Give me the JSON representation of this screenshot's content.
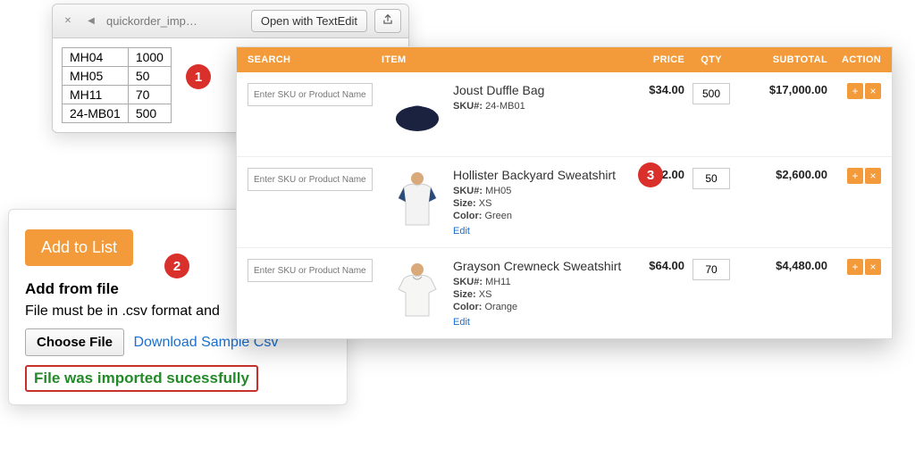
{
  "callouts": {
    "one": "1",
    "two": "2",
    "three": "3"
  },
  "csv": {
    "filename": "quickorder_imp…",
    "open_with_label": "Open with TextEdit",
    "rows": [
      {
        "sku": "MH04",
        "qty": "1000"
      },
      {
        "sku": "MH05",
        "qty": "50"
      },
      {
        "sku": "MH11",
        "qty": "70"
      },
      {
        "sku": "24-MB01",
        "qty": "500"
      }
    ]
  },
  "addfile": {
    "add_to_list_label": "Add to List",
    "heading": "Add from file",
    "note": "File must be in .csv format and",
    "choose_label": "Choose File",
    "download_label": "Download Sample Csv",
    "success_msg": "File was imported sucessfully"
  },
  "grid": {
    "headers": {
      "search": "SEARCH",
      "item": "ITEM",
      "price": "PRICE",
      "qty": "QTY",
      "subtotal": "SUBTOTAL",
      "action": "ACTION"
    },
    "sku_placeholder": "Enter SKU or Product Name",
    "sku_prefix": "SKU#:",
    "size_label": "Size:",
    "color_label": "Color:",
    "edit_label": "Edit",
    "rows": [
      {
        "name": "Joust Duffle Bag",
        "sku": "24-MB01",
        "price": "$34.00",
        "qty": "500",
        "subtotal": "$17,000.00",
        "has_options": false,
        "thumb_kind": "bag"
      },
      {
        "name": "Hollister Backyard Sweatshirt",
        "sku": "MH05",
        "size": "XS",
        "color": "Green",
        "price": "$52.00",
        "qty": "50",
        "subtotal": "$2,600.00",
        "has_options": true,
        "thumb_kind": "shirt1"
      },
      {
        "name": "Grayson Crewneck Sweatshirt",
        "sku": "MH11",
        "size": "XS",
        "color": "Orange",
        "price": "$64.00",
        "qty": "70",
        "subtotal": "$4,480.00",
        "has_options": true,
        "thumb_kind": "shirt2"
      }
    ]
  }
}
